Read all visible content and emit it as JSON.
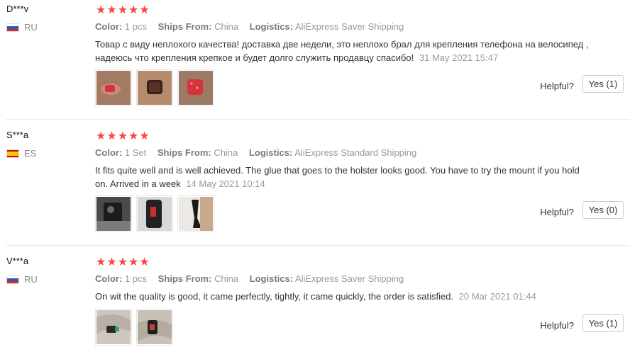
{
  "reviews": [
    {
      "user": "D***v",
      "country": "RU",
      "rating": 5,
      "stars": "★★★★★",
      "color_label": "Color:",
      "color_value": "1 pcs",
      "ships_label": "Ships From:",
      "ships_value": "China",
      "logistics_label": "Logistics:",
      "logistics_value": "AliExpress Saver Shipping",
      "text": "Товар с виду неплохого качества! доставка две недели, это неплохо брал для крепления телефона на велосипед , надеюсь что крепления крепкое и будет долго служить продавцу спасибо!",
      "date": "31 May 2021 15:47",
      "helpful_label": "Helpful?",
      "yes_label": "Yes (1)"
    },
    {
      "user": "S***a",
      "country": "ES",
      "rating": 5,
      "stars": "★★★★★",
      "color_label": "Color:",
      "color_value": "1 Set",
      "ships_label": "Ships From:",
      "ships_value": "China",
      "logistics_label": "Logistics:",
      "logistics_value": "AliExpress Standard Shipping",
      "text": "It fits quite well and is well achieved. The glue that goes to the holster looks good. You have to try the mount if you hold on. Arrived in a week",
      "date": "14 May 2021 10:14",
      "helpful_label": "Helpful?",
      "yes_label": "Yes (0)"
    },
    {
      "user": "V***a",
      "country": "RU",
      "rating": 5,
      "stars": "★★★★★",
      "color_label": "Color:",
      "color_value": "1 pcs",
      "ships_label": "Ships From:",
      "ships_value": "China",
      "logistics_label": "Logistics:",
      "logistics_value": "AliExpress Saver Shipping",
      "text": "On wit the quality is good, it came perfectly, tightly, it came quickly, the order is satisfied.",
      "date": "20 Mar 2021 01:44",
      "helpful_label": "Helpful?",
      "yes_label": "Yes (1)"
    }
  ],
  "colors": {
    "star": "#f44848",
    "muted": "#999999"
  }
}
